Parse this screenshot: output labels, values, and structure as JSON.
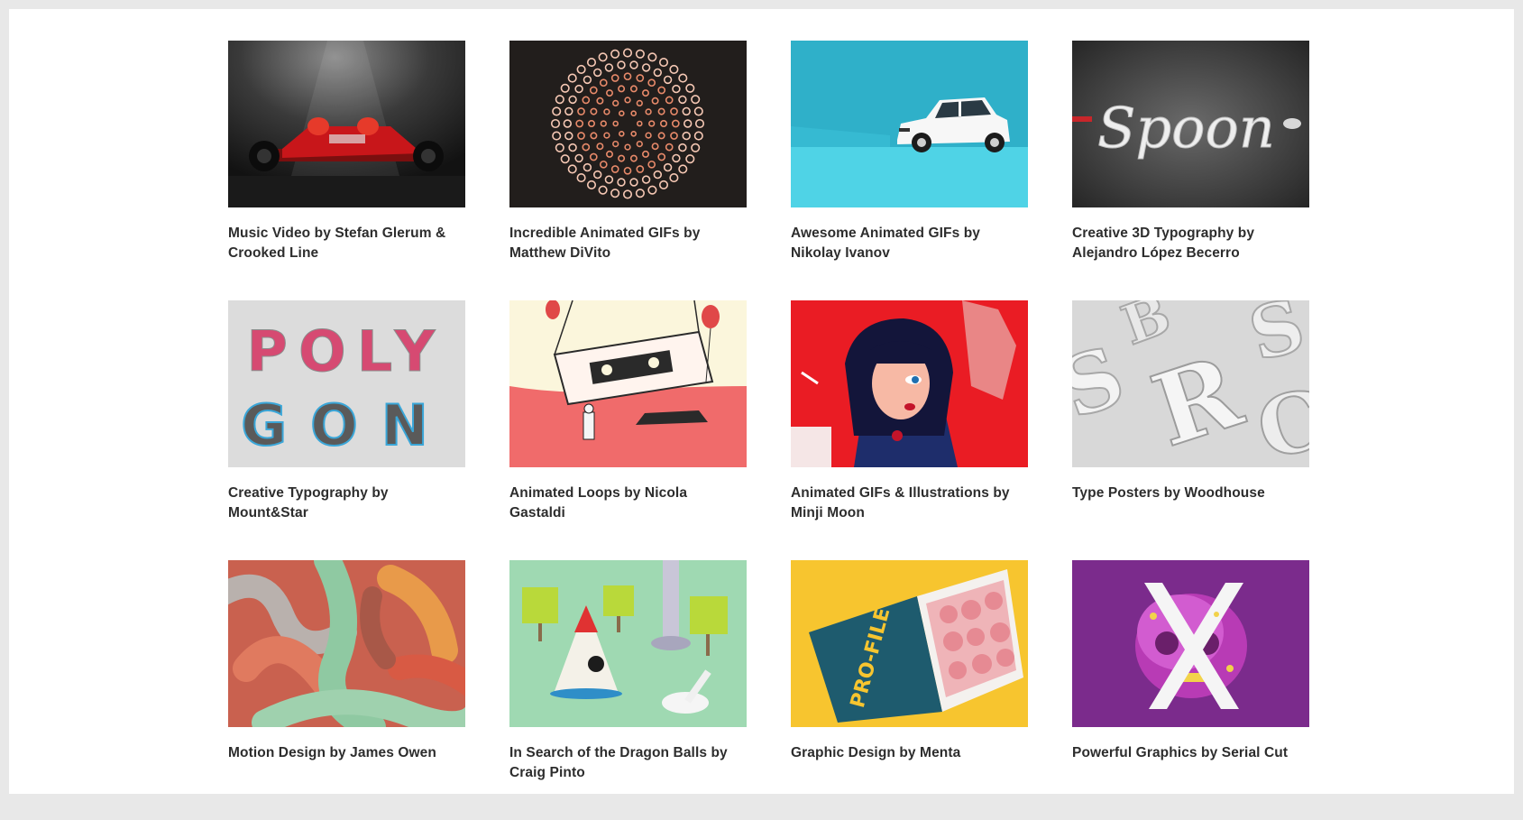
{
  "gallery": {
    "items": [
      {
        "title": "Music Video by Stefan Glerum & Crooked Line"
      },
      {
        "title": "Incredible Animated GIFs by Matthew DiVito"
      },
      {
        "title": "Awesome Animated GIFs by Nikolay Ivanov"
      },
      {
        "title": "Creative 3D Typography by Alejandro López Becerro",
        "thumb_text": "Spoon"
      },
      {
        "title": "Creative Typography by Mount&Star",
        "thumb_text_top": "POLY",
        "thumb_text_bottom": "GON"
      },
      {
        "title": "Animated Loops by Nicola Gastaldi"
      },
      {
        "title": "Animated GIFs & Illustrations by Minji Moon"
      },
      {
        "title": "Type Posters by Woodhouse"
      },
      {
        "title": "Motion Design by James Owen"
      },
      {
        "title": "In Search of the Dragon Balls by Craig Pinto"
      },
      {
        "title": "Graphic Design by Menta",
        "thumb_text": "PRO-FILE"
      },
      {
        "title": "Powerful Graphics by Serial Cut"
      }
    ]
  },
  "colors": {
    "background": "#e8e8e8",
    "page": "#ffffff",
    "caption_text": "#2d2d2d"
  }
}
